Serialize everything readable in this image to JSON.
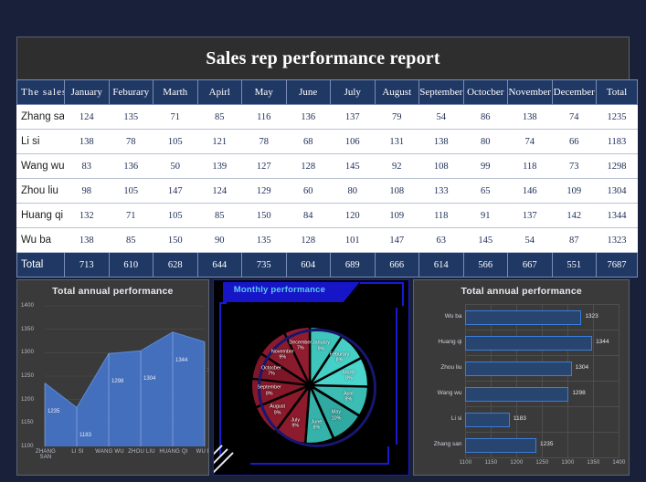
{
  "report": {
    "title": "Sales rep performance report"
  },
  "table": {
    "headers": [
      "The sales",
      "January",
      "Feburary",
      "Marth",
      "Apirl",
      "May",
      "June",
      "July",
      "August",
      "September",
      "Octocber",
      "November",
      "December",
      "Total"
    ],
    "rows": [
      {
        "name": "Zhang san",
        "values": [
          124,
          135,
          71,
          85,
          116,
          136,
          137,
          79,
          54,
          86,
          138,
          74
        ],
        "total": 1235
      },
      {
        "name": "Li si",
        "values": [
          138,
          78,
          105,
          121,
          78,
          68,
          106,
          131,
          138,
          80,
          74,
          66
        ],
        "total": 1183
      },
      {
        "name": "Wang wu",
        "values": [
          83,
          136,
          50,
          139,
          127,
          128,
          145,
          92,
          108,
          99,
          118,
          73
        ],
        "total": 1298
      },
      {
        "name": "Zhou liu",
        "values": [
          98,
          105,
          147,
          124,
          129,
          60,
          80,
          108,
          133,
          65,
          146,
          109
        ],
        "total": 1304
      },
      {
        "name": "Huang qi",
        "values": [
          132,
          71,
          105,
          85,
          150,
          84,
          120,
          109,
          118,
          91,
          137,
          142
        ],
        "total": 1344
      },
      {
        "name": "Wu ba",
        "values": [
          138,
          85,
          150,
          90,
          135,
          128,
          101,
          147,
          63,
          145,
          54,
          87
        ],
        "total": 1323
      }
    ],
    "total_row": {
      "name": "Total",
      "values": [
        713,
        610,
        628,
        644,
        735,
        604,
        689,
        666,
        614,
        566,
        667,
        551
      ],
      "total": 7687
    }
  },
  "chart_data": [
    {
      "type": "area",
      "title": "Total annual performance",
      "categories": [
        "ZHANG SAN",
        "LI SI",
        "WANG WU",
        "ZHOU LIU",
        "HUANG QI",
        "WU BA"
      ],
      "values": [
        1235,
        1183,
        1298,
        1304,
        1344,
        1323
      ],
      "ylim": [
        1100,
        1400
      ],
      "yticks": [
        1100,
        1150,
        1200,
        1250,
        1300,
        1350,
        1400
      ],
      "xlabel": "",
      "ylabel": "",
      "grid": true,
      "legend": "none",
      "series_color": "#4472c4"
    },
    {
      "type": "pie",
      "title": "Monthly performance",
      "labels": [
        "January",
        "Feburary",
        "Marth",
        "Apirl",
        "May",
        "June",
        "July",
        "August",
        "September",
        "Octocber",
        "November",
        "December"
      ],
      "values": [
        713,
        610,
        628,
        644,
        735,
        604,
        689,
        666,
        614,
        566,
        667,
        551
      ],
      "percent_labels": [
        "9%",
        "8%",
        "8%",
        "8%",
        "10%",
        "8%",
        "9%",
        "9%",
        "8%",
        "7%",
        "9%",
        "7%"
      ],
      "legend": "none",
      "colors": [
        "#3ec6bd",
        "#45cfc6",
        "#4ad6cd",
        "#3bbdb4",
        "#2fa9a1",
        "#35b3ab",
        "#8e1b2d",
        "#8b1a2b",
        "#87182a",
        "#7d1627",
        "#8a1a2c",
        "#921c2f"
      ]
    },
    {
      "type": "bar",
      "orientation": "horizontal",
      "title": "Total annual performance",
      "categories": [
        "Wu ba",
        "Huang qi",
        "Zhou liu",
        "Wang wu",
        "Li si",
        "Zhang san"
      ],
      "values": [
        1323,
        1344,
        1304,
        1298,
        1183,
        1235
      ],
      "xlim": [
        1100,
        1400
      ],
      "xticks": [
        1100,
        1150,
        1200,
        1250,
        1300,
        1350,
        1400
      ],
      "grid": true,
      "legend": "none",
      "bar_color": "#27456f",
      "bar_border": "#3a7ddc"
    }
  ]
}
